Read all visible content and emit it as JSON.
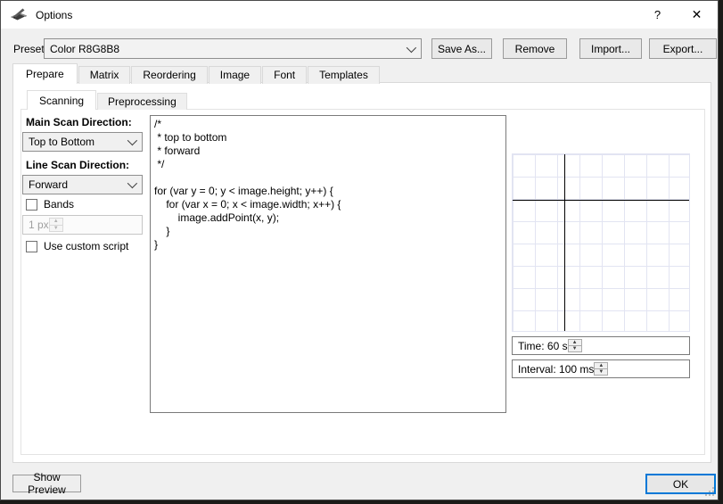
{
  "colors": {
    "accent": "#0078d7",
    "grid_line": "#e2e4f2",
    "axis": "#000000",
    "titlebar_bg": "#ffffff",
    "dialog_bg": "#f0f0f0"
  },
  "window": {
    "title": "Options",
    "help": "?",
    "close": "✕"
  },
  "preset": {
    "label": "Preset:",
    "value": "Color R8G8B8"
  },
  "toolbar": {
    "save_as": "Save As...",
    "remove": "Remove",
    "import": "Import...",
    "export": "Export..."
  },
  "tabs": [
    {
      "label": "Prepare",
      "active": true
    },
    {
      "label": "Matrix",
      "active": false
    },
    {
      "label": "Reordering",
      "active": false
    },
    {
      "label": "Image",
      "active": false
    },
    {
      "label": "Font",
      "active": false
    },
    {
      "label": "Templates",
      "active": false
    }
  ],
  "subtabs": [
    {
      "label": "Scanning",
      "active": true
    },
    {
      "label": "Preprocessing",
      "active": false
    }
  ],
  "scanning": {
    "main_scan_label": "Main Scan Direction:",
    "main_scan_value": "Top to Bottom",
    "line_scan_label": "Line Scan Direction:",
    "line_scan_value": "Forward",
    "bands_label": "Bands",
    "bands_checked": false,
    "bands_size_value": "1 px",
    "custom_script_label": "Use custom script",
    "custom_script_checked": false,
    "code": "/*\n * top to bottom\n * forward\n */\n\nfor (var y = 0; y < image.height; y++) {\n    for (var x = 0; x < image.width; x++) {\n        image.addPoint(x, y);\n    }\n}",
    "time_value": "Time: 60 s",
    "interval_value": "Interval: 100 ms"
  },
  "icons": {
    "spin_up": "▲",
    "spin_down": "▼"
  },
  "footer": {
    "show_preview": "Show Preview",
    "ok": "OK"
  }
}
